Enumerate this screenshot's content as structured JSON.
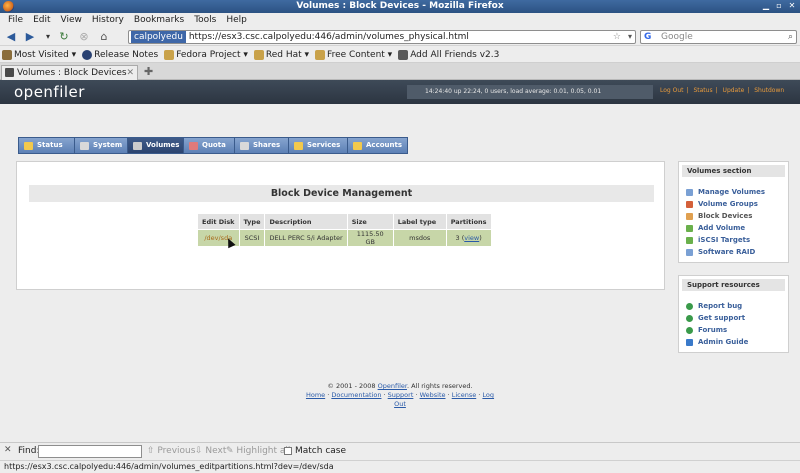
{
  "window": {
    "title": "Volumes : Block Devices - Mozilla Firefox"
  },
  "menu": [
    "File",
    "Edit",
    "View",
    "History",
    "Bookmarks",
    "Tools",
    "Help"
  ],
  "nav": {
    "site_badge": "calpolyedu",
    "url": "https://esx3.csc.calpolyedu:446/admin/volumes_physical.html",
    "search_placeholder": "Google"
  },
  "bookmarks": [
    {
      "label": "Most Visited ▾",
      "icon": "gear-icon",
      "color": "#8a6d3b"
    },
    {
      "label": "Release Notes",
      "icon": "fedora-icon",
      "color": "#294172"
    },
    {
      "label": "Fedora Project ▾",
      "icon": "folder-icon",
      "color": "#c9a24a"
    },
    {
      "label": "Red Hat ▾",
      "icon": "folder-icon",
      "color": "#c9a24a"
    },
    {
      "label": "Free Content ▾",
      "icon": "folder-icon",
      "color": "#c9a24a"
    },
    {
      "label": "Add All Friends v2.3",
      "icon": "page-icon",
      "color": "#5a5a5a"
    }
  ],
  "tab": {
    "label": "Volumes : Block Devices"
  },
  "openfiler": {
    "logo": "openfiler",
    "status": "14:24:40 up 22:24, 0 users, load average: 0.01, 0.05, 0.01",
    "links": [
      "Log Out",
      "Status",
      "Update",
      "Shutdown"
    ],
    "tabs": [
      {
        "label": "Status",
        "color": "#f2c94c",
        "active": false
      },
      {
        "label": "System",
        "color": "#d9d9d9",
        "active": false
      },
      {
        "label": "Volumes",
        "color": "#cccccc",
        "active": true
      },
      {
        "label": "Quota",
        "color": "#e07a7a",
        "active": false
      },
      {
        "label": "Shares",
        "color": "#d9d9d9",
        "active": false
      },
      {
        "label": "Services",
        "color": "#f2c94c",
        "active": false
      },
      {
        "label": "Accounts",
        "color": "#f2c94c",
        "active": false
      }
    ],
    "main_title": "Block Device Management",
    "table": {
      "headers": [
        "Edit Disk",
        "Type",
        "Description",
        "Size",
        "Label type",
        "Partitions"
      ],
      "rows": [
        {
          "disk": "/dev/sda",
          "type": "SCSI",
          "description": "DELL PERC 5/i Adapter",
          "size": "1115.50 GB",
          "label_type": "msdos",
          "partitions": "3",
          "view": "view"
        }
      ]
    },
    "volumes_section": {
      "title": "Volumes section",
      "items": [
        {
          "label": "Manage Volumes",
          "color": "#7aa0d4"
        },
        {
          "label": "Volume Groups",
          "color": "#d4603a"
        },
        {
          "label": "Block Devices",
          "color": "#e0a050"
        },
        {
          "label": "Add Volume",
          "color": "#6ab04c"
        },
        {
          "label": "iSCSI Targets",
          "color": "#6ab04c"
        },
        {
          "label": "Software RAID",
          "color": "#7aa0d4"
        }
      ]
    },
    "support": {
      "title": "Support resources",
      "items": [
        {
          "label": "Report bug",
          "color": "#3a9a4a"
        },
        {
          "label": "Get support",
          "color": "#3a9a4a"
        },
        {
          "label": "Forums",
          "color": "#3a9a4a"
        },
        {
          "label": "Admin Guide",
          "color": "#3a7aca"
        }
      ]
    },
    "footer": {
      "copyright": "© 2001 - 2008",
      "brand": "Openfiler",
      "rights": ". All rights reserved.",
      "links": [
        "Home",
        "Documentation",
        "Support",
        "Website",
        "License",
        "Log Out"
      ]
    }
  },
  "findbar": {
    "label": "Find:",
    "previous": "Previous",
    "next": "Next",
    "highlight": "Highlight all",
    "match_case": "Match case"
  },
  "status_url": "https://esx3.csc.calpolyedu:446/admin/volumes_editpartitions.html?dev=/dev/sda"
}
